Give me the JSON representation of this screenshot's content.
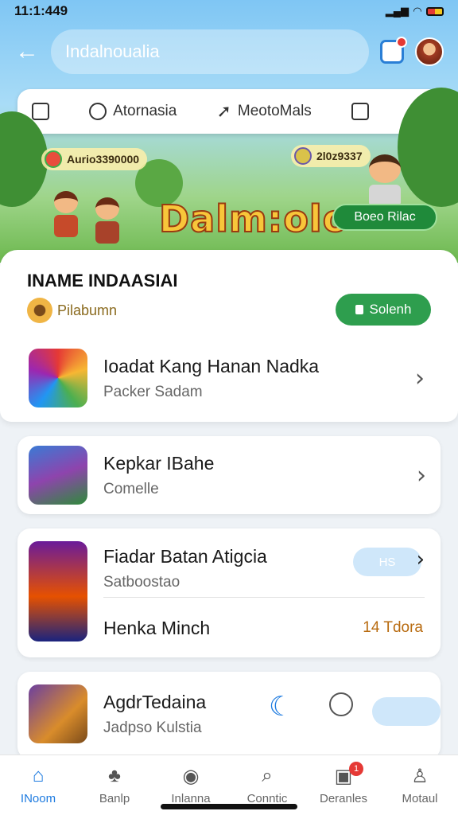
{
  "status": {
    "time": "11:1:449"
  },
  "header": {
    "search_value": "Indalnoualia",
    "back_icon": "arrow-left-icon",
    "notification_icon": "notification-icon",
    "avatar_icon": "avatar-icon"
  },
  "categories": [
    {
      "label": "",
      "icon": "device-icon"
    },
    {
      "label": "Atornasia",
      "icon": "circle-icon"
    },
    {
      "label": "MeotoMals",
      "icon": "cursor-icon"
    },
    {
      "label": "",
      "icon": "square-icon"
    },
    {
      "label": "",
      "icon": "speed-icon"
    }
  ],
  "banner": {
    "coins_left": "Aurio3390000",
    "coins_right": "2l0z9337",
    "game_logo": "Dalm:olo",
    "play_label": "Boeo Rilac"
  },
  "sheet": {
    "title": "INAME INDAASIAI",
    "publisher": "Pilabumn",
    "search_label": "Solenh"
  },
  "items": [
    {
      "title": "Ioadat Kang Hanan Nadka",
      "subtitle": "Packer Sadam"
    },
    {
      "title": "Kepkar IBahe",
      "subtitle": "Comelle"
    },
    {
      "title": "Fiadar Batan Atigcia",
      "subtitle": "Satboostao",
      "pill": "HS"
    },
    {
      "title": "Henka Minch",
      "value": "14 Tdora"
    },
    {
      "title": "AgdrTedaina",
      "subtitle": "Jadpso Kulstia"
    }
  ],
  "nav": [
    {
      "label": "INoom",
      "icon": "home-icon",
      "active": true
    },
    {
      "label": "Banlp",
      "icon": "cluster-icon"
    },
    {
      "label": "Inlanna",
      "icon": "compass-icon"
    },
    {
      "label": "Conntic",
      "icon": "search-icon"
    },
    {
      "label": "Deranles",
      "icon": "inbox-icon",
      "badge": "1"
    },
    {
      "label": "Motaul",
      "icon": "profile-icon"
    }
  ],
  "colors": {
    "accent": "#1e7be0",
    "green": "#2e9e4e",
    "badge": "#e53935"
  }
}
